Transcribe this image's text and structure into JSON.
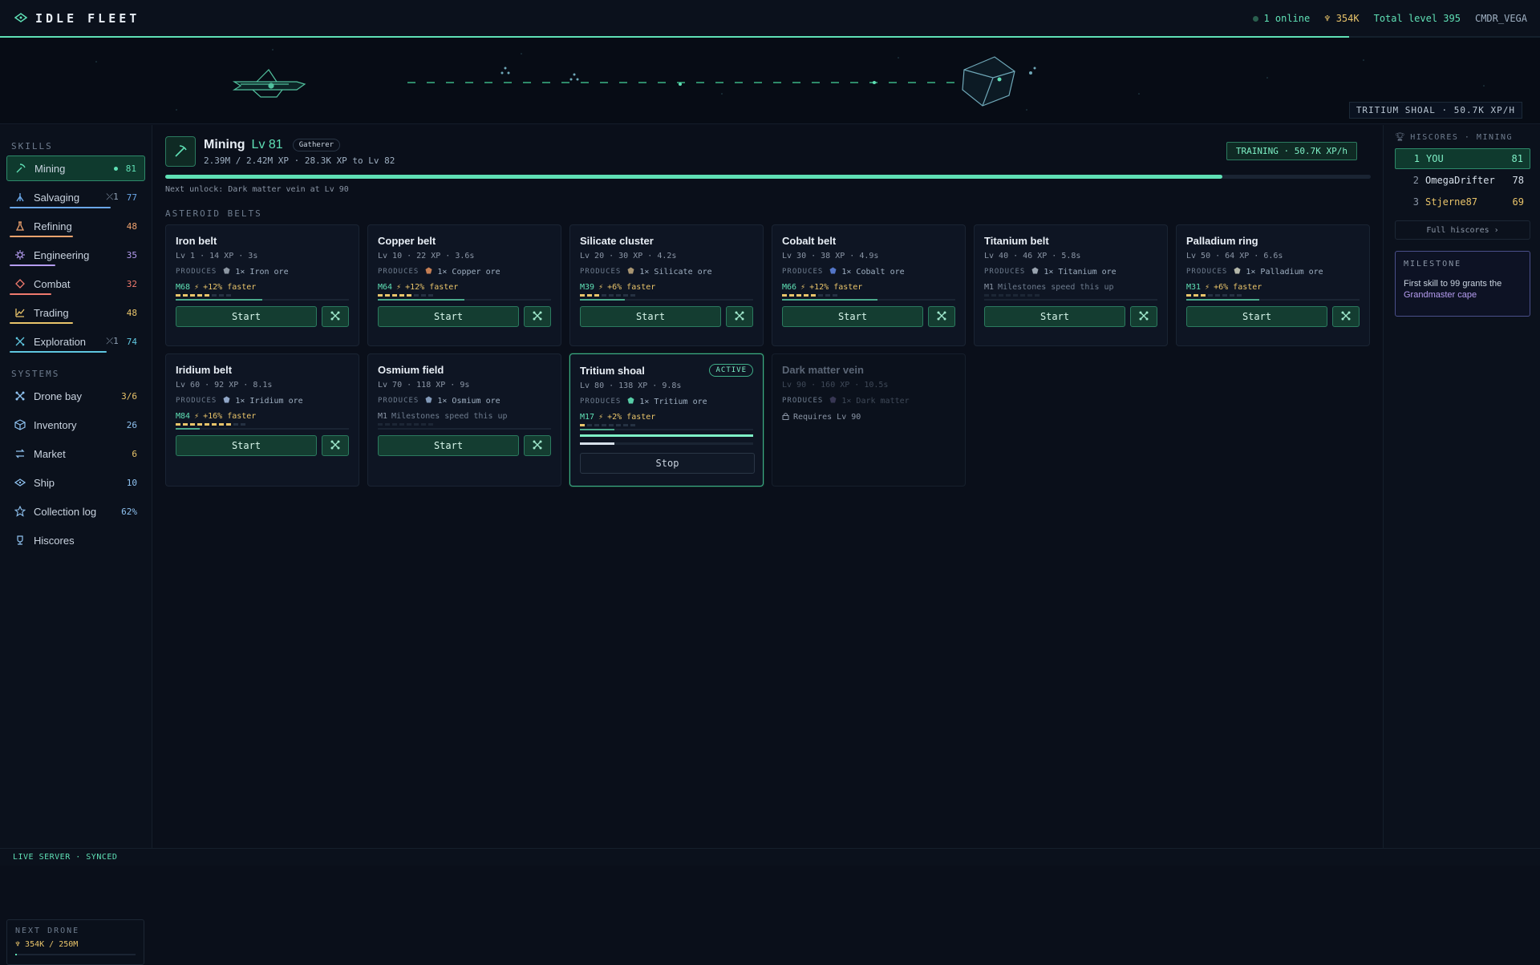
{
  "topbar": {
    "app_title": "IDLE FLEET",
    "online": "1 online",
    "credits": "354K",
    "total_level": "Total level 395",
    "username": "CMDR_VEGA",
    "progress_fraction": 0.876
  },
  "banner": {
    "tag": "TRITIUM SHOAL · 50.7K XP/H"
  },
  "sidebar": {
    "skills_heading": "SKILLS",
    "skills": [
      {
        "label": "Mining",
        "value": "81",
        "icon": "pickaxe-icon",
        "active": true,
        "color": "#5fe0b5",
        "fill": 0.81
      },
      {
        "label": "Salvaging",
        "badge": "⤫1",
        "value": "77",
        "icon": "salvage-icon",
        "color": "#6aa7e8",
        "fill": 0.77
      },
      {
        "label": "Refining",
        "value": "48",
        "icon": "flask-icon",
        "color": "#f0a36e",
        "fill": 0.48
      },
      {
        "label": "Engineering",
        "value": "35",
        "icon": "gear-icon",
        "color": "#b59cf0",
        "fill": 0.35
      },
      {
        "label": "Combat",
        "value": "32",
        "icon": "crosshair-icon",
        "color": "#f07a6e",
        "fill": 0.32
      },
      {
        "label": "Trading",
        "value": "48",
        "icon": "chart-icon",
        "color": "#e9c46a",
        "fill": 0.48
      },
      {
        "label": "Exploration",
        "badge": "⤫1",
        "value": "74",
        "icon": "compass-icon",
        "color": "#5fc7e0",
        "fill": 0.74
      }
    ],
    "systems_heading": "SYSTEMS",
    "systems": [
      {
        "label": "Drone bay",
        "value": "3/6",
        "icon": "drone-icon",
        "color": "#e9c46a"
      },
      {
        "label": "Inventory",
        "value": "26",
        "icon": "box-icon",
        "color": "#8fc2f0"
      },
      {
        "label": "Market",
        "value": "6",
        "icon": "exchange-icon",
        "color": "#e9c46a"
      },
      {
        "label": "Ship",
        "value": "10",
        "icon": "ship-icon",
        "color": "#8fc2f0"
      },
      {
        "label": "Collection log",
        "value": "62%",
        "icon": "star-icon",
        "color": "#8fc2f0"
      },
      {
        "label": "Hiscores",
        "value": "",
        "icon": "trophy-icon",
        "color": "#8fc2f0"
      }
    ],
    "next_drone": {
      "heading": "NEXT DRONE",
      "value": "354K / 250M",
      "fraction": 0.0014
    }
  },
  "skill_header": {
    "name": "Mining",
    "level": "Lv 81",
    "title_badge": "Gatherer",
    "xp_line": "2.39M / 2.42M XP · 28.3K XP to Lv 82",
    "training": "TRAINING · 50.7K XP/h",
    "progress_fraction": 0.877,
    "next_unlock": "Next unlock: Dark matter vein at Lv 90"
  },
  "section_label": "ASTEROID BELTS",
  "produces_label": "PRODUCES",
  "start_label": "Start",
  "stop_label": "Stop",
  "active_label": "ACTIVE",
  "belts": [
    {
      "name": "Iron belt",
      "meta": "Lv 1 · 14 XP · 3s",
      "produces": "1× Iron ore",
      "ore_color": "#9aa4b0",
      "ms": "M68",
      "ms_text": "+12% faster",
      "dashes": 5,
      "progress": 0.5
    },
    {
      "name": "Copper belt",
      "meta": "Lv 10 · 22 XP · 3.6s",
      "produces": "1× Copper ore",
      "ore_color": "#d98a5a",
      "ms": "M64",
      "ms_text": "+12% faster",
      "dashes": 5,
      "progress": 0.5
    },
    {
      "name": "Silicate cluster",
      "meta": "Lv 20 · 30 XP · 4.2s",
      "produces": "1× Silicate ore",
      "ore_color": "#b8a27a",
      "ms": "M39",
      "ms_text": "+6% faster",
      "dashes": 3,
      "progress": 0.26
    },
    {
      "name": "Cobalt belt",
      "meta": "Lv 30 · 38 XP · 4.9s",
      "produces": "1× Cobalt ore",
      "ore_color": "#5b7fd9",
      "ms": "M66",
      "ms_text": "+12% faster",
      "dashes": 5,
      "progress": 0.55
    },
    {
      "name": "Titanium belt",
      "meta": "Lv 40 · 46 XP · 5.8s",
      "produces": "1× Titanium ore",
      "ore_color": "#a8b3bf",
      "ms": "M1",
      "ms_text": "Milestones speed this up",
      "dashes": 0,
      "progress": 0.0
    },
    {
      "name": "Palladium ring",
      "meta": "Lv 50 · 64 XP · 6.6s",
      "produces": "1× Palladium ore",
      "ore_color": "#c7c9b8",
      "ms": "M31",
      "ms_text": "+6% faster",
      "dashes": 3,
      "progress": 0.42
    },
    {
      "name": "Iridium belt",
      "meta": "Lv 60 · 92 XP · 8.1s",
      "produces": "1× Iridium ore",
      "ore_color": "#9fb6d9",
      "ms": "M84",
      "ms_text": "+16% faster",
      "dashes": 8,
      "progress": 0.14
    },
    {
      "name": "Osmium field",
      "meta": "Lv 70 · 118 XP · 9s",
      "produces": "1× Osmium ore",
      "ore_color": "#8fa7c9",
      "ms": "M1",
      "ms_text": "Milestones speed this up",
      "dashes": 0,
      "progress": 0.0
    },
    {
      "name": "Tritium shoal",
      "meta": "Lv 80 · 138 XP · 9.8s",
      "produces": "1× Tritium ore",
      "ore_color": "#5fe0b5",
      "ms": "M17",
      "ms_text": "+2% faster",
      "dashes": 1,
      "progress": 0.2,
      "active": true,
      "action_progress": 1.0
    },
    {
      "name": "Dark matter vein",
      "meta": "Lv 90 · 160 XP · 10.5s",
      "produces": "1× Dark matter",
      "ore_color": "#7a6fa8",
      "locked": true,
      "lock_text": "Requires Lv 90"
    }
  ],
  "hiscores": {
    "heading": "HISCORES · MINING",
    "rows": [
      {
        "rank": "1",
        "name": "YOU",
        "level": "81",
        "me": true
      },
      {
        "rank": "2",
        "name": "OmegaDrifter",
        "level": "78"
      },
      {
        "rank": "3",
        "name": "Stjerne87",
        "level": "69"
      }
    ],
    "full_link": "Full hiscores ›"
  },
  "milestone": {
    "heading": "MILESTONE",
    "text_pre": "First skill to 99 grants the",
    "text_highlight": "Grandmaster cape"
  },
  "footer": {
    "status": "LIVE SERVER · SYNCED"
  }
}
